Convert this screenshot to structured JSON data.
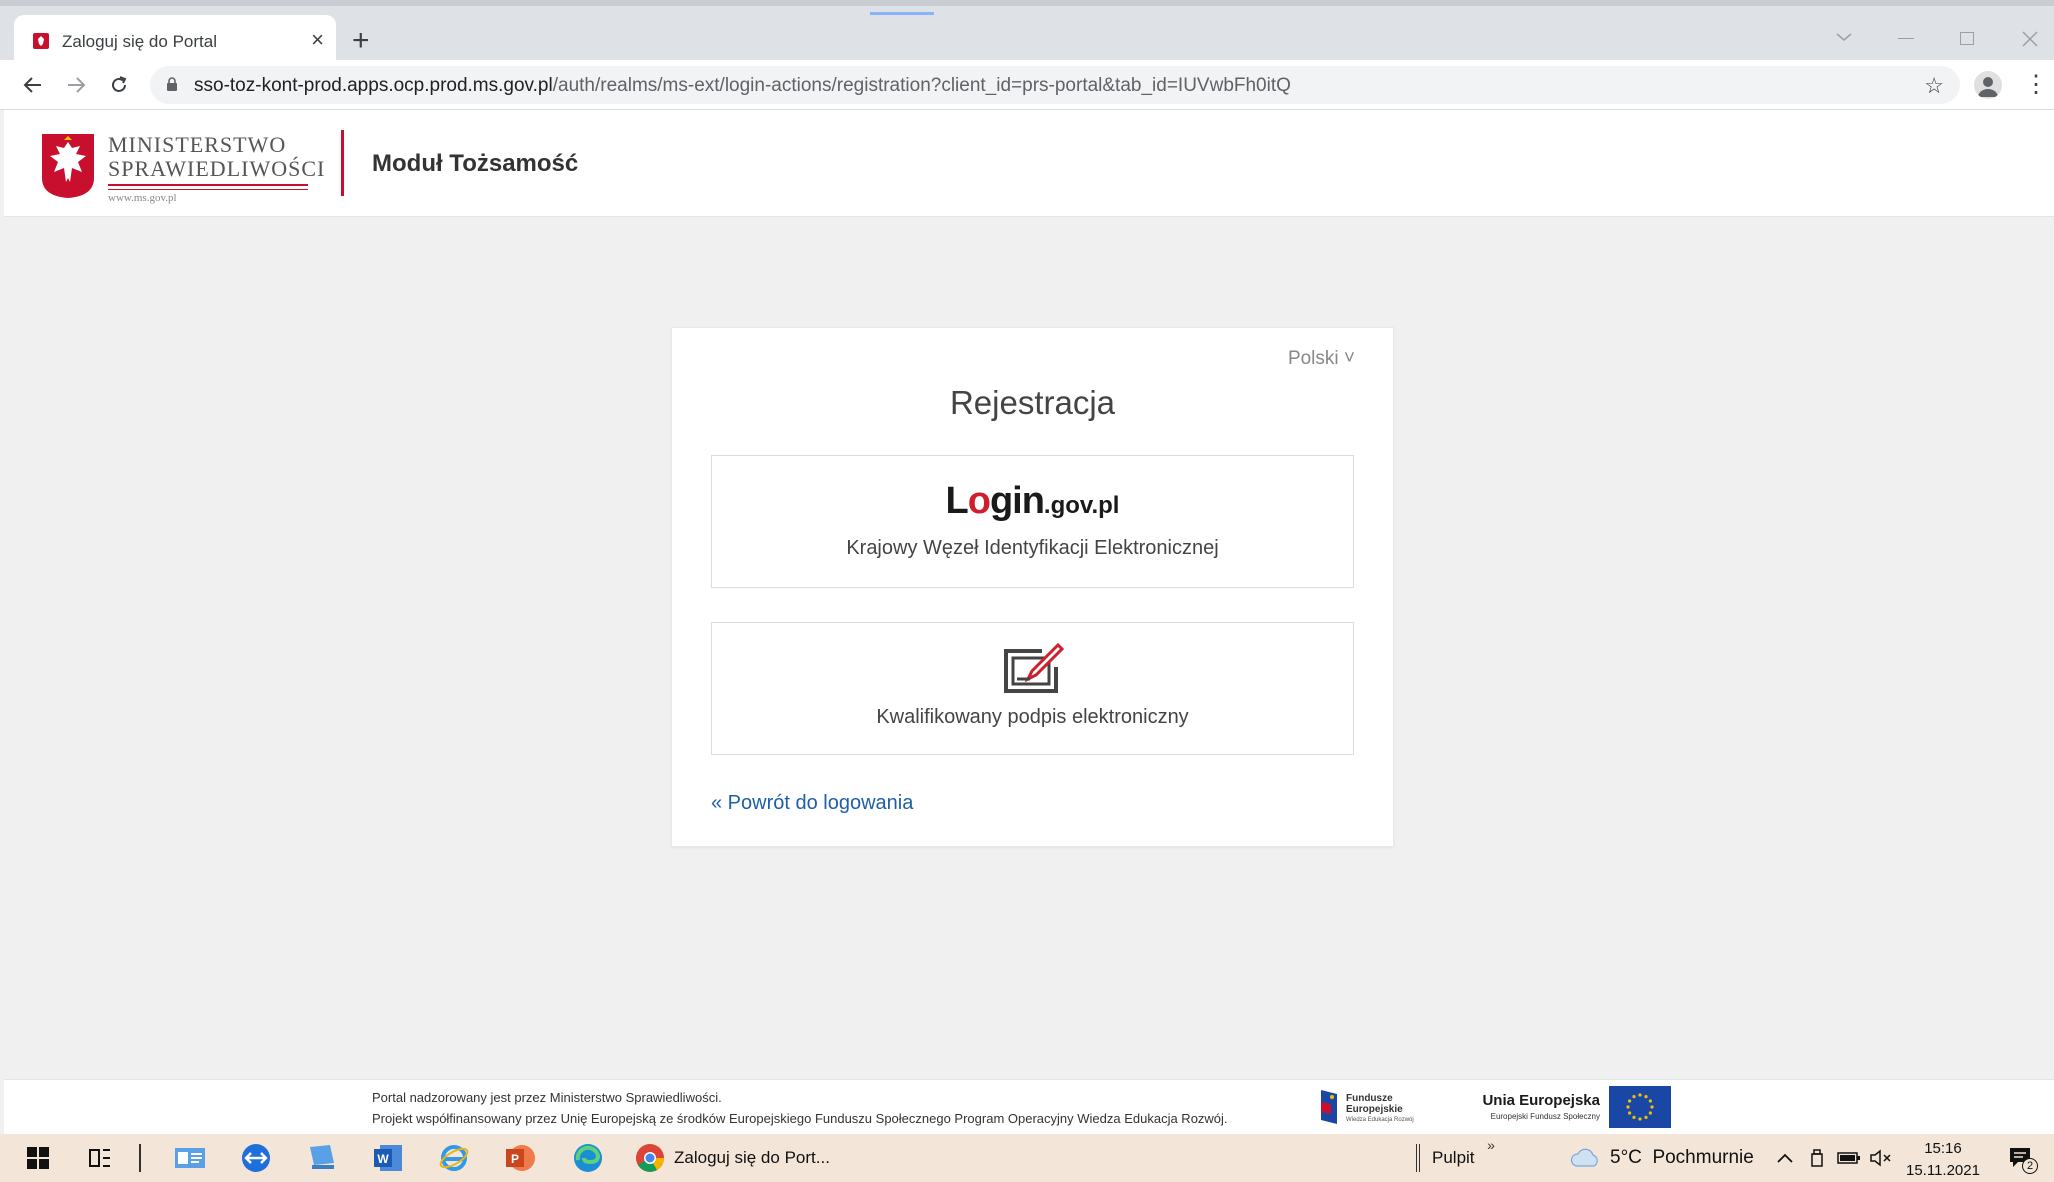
{
  "browser": {
    "tab_title": "Zaloguj się do Portal",
    "tab_close": "×",
    "new_tab": "+",
    "url_host": "sso-toz-kont-prod.apps.ocp.prod.ms.gov.pl",
    "url_path": "/auth/realms/ms-ext/login-actions/registration?client_id=prs-portal&tab_id=IUVwbFh0itQ",
    "star": "☆",
    "menu": "⋮"
  },
  "header": {
    "ministry_line1": "MINISTERSTWO",
    "ministry_line2": "SPRAWIEDLIWOŚCI",
    "ministry_www": "www.ms.gov.pl",
    "module_title": "Moduł Tożsamość"
  },
  "card": {
    "language": "Polski ˅",
    "title": "Rejestracja",
    "login_logo_l": "L",
    "login_logo_o": "o",
    "login_logo_gin": "gin",
    "login_logo_gov": ".gov.pl",
    "option1_label": "Krajowy Węzeł Identyfikacji Elektronicznej",
    "option2_label": "Kwalifikowany podpis elektroniczny",
    "back_link": "« Powrót do logowania"
  },
  "footer": {
    "line1": "Portal nadzorowany jest przez Ministerstwo Sprawiedliwości.",
    "line2": "Projekt współfinansowany przez Unię Europejską ze środków Europejskiego Funduszu Społecznego Program Operacyjny Wiedza Edukacja Rozwój.",
    "fe_name1": "Fundusze",
    "fe_name2": "Europejskie",
    "fe_sub": "Wiedza Edukacja Rozwój",
    "ue_title": "Unia Europejska",
    "ue_sub": "Europejski Fundusz Społeczny"
  },
  "taskbar": {
    "chrome_window": "Zaloguj się do Port...",
    "desktop": "Pulpit",
    "chevron": "»",
    "weather": "5°C  Pochmurnie",
    "time": "15:16",
    "date": "15.11.2021",
    "notifications": "2"
  },
  "colors": {
    "accent_red": "#c8102e",
    "link_blue": "#1f5ea8"
  }
}
